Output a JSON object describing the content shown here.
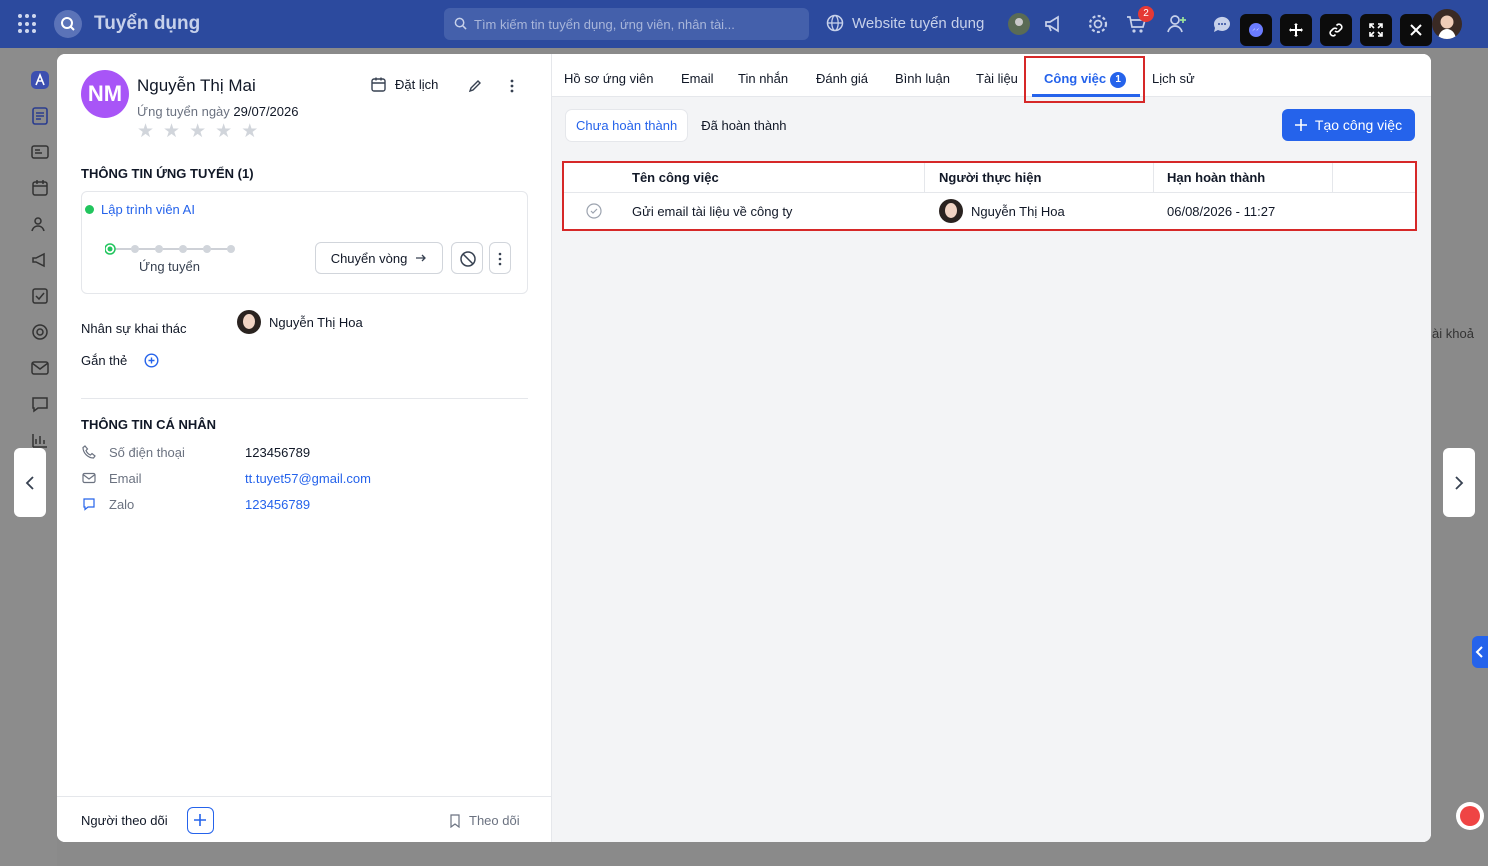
{
  "app": {
    "title": "Tuyển dụng"
  },
  "search": {
    "placeholder": "Tìm kiếm tin tuyển dụng, ứng viên, nhân tài..."
  },
  "header": {
    "website_label": "Website tuyển dụng",
    "cart_badge": "2"
  },
  "candidate": {
    "initials": "NM",
    "name": "Nguyễn Thị Mai",
    "applied_prefix": "Ứng tuyển ngày",
    "applied_date": "29/07/2026",
    "rating": 0,
    "star": "★",
    "schedule_label": "Đặt lịch"
  },
  "application": {
    "section_title": "THÔNG TIN ỨNG TUYỂN (1)",
    "job_title": "Lập trình viên AI",
    "stage_label": "Ứng tuyển",
    "move_label": "Chuyển vòng"
  },
  "recruiter": {
    "label": "Nhân sự khai thác",
    "name": "Nguyễn Thị Hoa"
  },
  "tags": {
    "label": "Gắn thẻ"
  },
  "personal": {
    "section_title": "THÔNG TIN CÁ NHÂN",
    "phone_label": "Số điện thoại",
    "phone_value": "123456789",
    "email_label": "Email",
    "email_value": "tt.tuyet57@gmail.com",
    "zalo_label": "Zalo",
    "zalo_value": "123456789"
  },
  "footer": {
    "followers_label": "Người theo dõi",
    "follow_label": "Theo dõi"
  },
  "tabs": [
    {
      "label": "Hồ sơ ứng viên"
    },
    {
      "label": "Email"
    },
    {
      "label": "Tin nhắn"
    },
    {
      "label": "Đánh giá"
    },
    {
      "label": "Bình luận"
    },
    {
      "label": "Tài liệu"
    },
    {
      "label": "Công việc",
      "badge": "1"
    },
    {
      "label": "Lịch sử"
    }
  ],
  "tasks": {
    "filter_pending": "Chưa hoàn thành",
    "filter_done": "Đã hoàn thành",
    "create_label": "Tạo công việc",
    "columns": [
      "Tên công việc",
      "Người thực hiện",
      "Hạn hoàn thành"
    ],
    "rows": [
      {
        "name": "Gửi email tài liệu về công ty",
        "assignee": "Nguyễn Thị Hoa",
        "deadline": "06/08/2026 - 11:27"
      }
    ]
  },
  "background": {
    "partial_text": "ài khoả"
  },
  "colors": {
    "primary": "#2563eb",
    "header": "#2c4a9e",
    "avatar": "#a855f7",
    "highlight": "#d62828",
    "status_dot": "#22c55e"
  }
}
